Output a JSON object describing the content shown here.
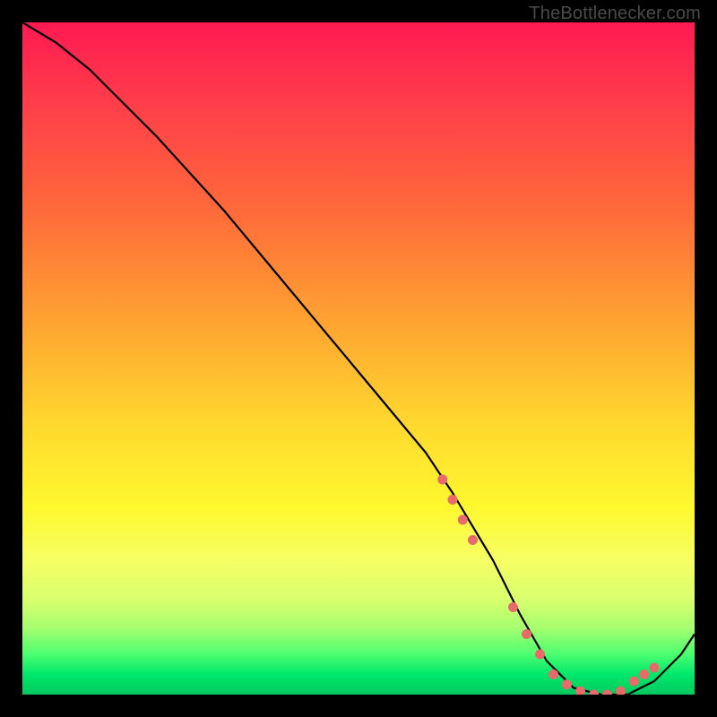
{
  "watermark": {
    "text": "TheBottlenecker.com"
  },
  "colors": {
    "background": "#000000",
    "curve": "#000000",
    "marker": "#e96a6a",
    "gradient_top": "#ff1a52",
    "gradient_bottom": "#00c85e"
  },
  "chart_data": {
    "type": "line",
    "title": "",
    "xlabel": "",
    "ylabel": "",
    "xlim": [
      0,
      100
    ],
    "ylim": [
      0,
      100
    ],
    "grid": false,
    "legend": false,
    "series": [
      {
        "name": "bottleneck-curve",
        "x": [
          0,
          5,
          10,
          20,
          30,
          40,
          50,
          60,
          64,
          70,
          74,
          78,
          82,
          86,
          90,
          94,
          98,
          100
        ],
        "values": [
          100,
          97,
          93,
          83,
          72,
          60,
          48,
          36,
          30,
          20,
          12,
          5,
          1,
          0,
          0,
          2,
          6,
          9
        ]
      }
    ],
    "markers": [
      {
        "name": "valley-marker-1",
        "x": 62.5,
        "y": 32
      },
      {
        "name": "valley-marker-2",
        "x": 64.0,
        "y": 29
      },
      {
        "name": "valley-marker-3",
        "x": 65.5,
        "y": 26
      },
      {
        "name": "valley-marker-4",
        "x": 67.0,
        "y": 23
      },
      {
        "name": "valley-marker-5",
        "x": 73.0,
        "y": 13
      },
      {
        "name": "valley-marker-6",
        "x": 75.0,
        "y": 9
      },
      {
        "name": "valley-marker-7",
        "x": 77.0,
        "y": 6
      },
      {
        "name": "valley-marker-8",
        "x": 79.0,
        "y": 3
      },
      {
        "name": "valley-marker-9",
        "x": 81.0,
        "y": 1.5
      },
      {
        "name": "valley-marker-10",
        "x": 83.0,
        "y": 0.5
      },
      {
        "name": "valley-marker-11",
        "x": 85.0,
        "y": 0
      },
      {
        "name": "valley-marker-12",
        "x": 87.0,
        "y": 0
      },
      {
        "name": "valley-marker-13",
        "x": 89.0,
        "y": 0.5
      },
      {
        "name": "valley-marker-14",
        "x": 91.0,
        "y": 2
      },
      {
        "name": "valley-marker-15",
        "x": 92.5,
        "y": 3
      },
      {
        "name": "valley-marker-16",
        "x": 94.0,
        "y": 4
      }
    ]
  }
}
